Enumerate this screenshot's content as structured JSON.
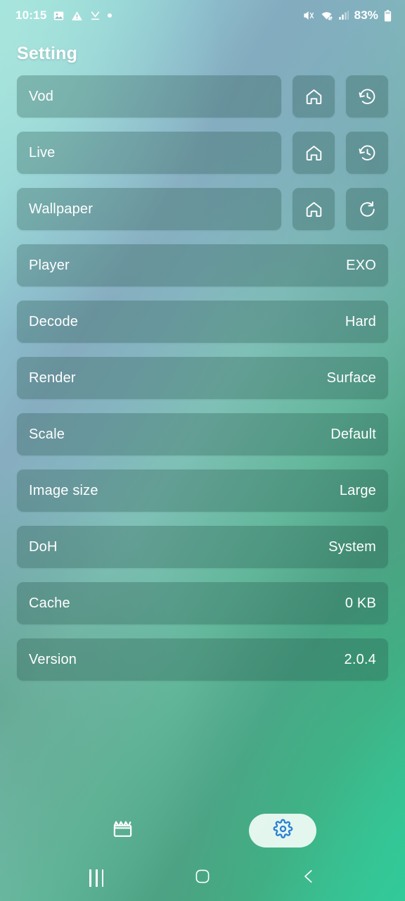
{
  "status_bar": {
    "time": "10:15",
    "battery_percent": "83%",
    "left_icons": [
      "photo-icon",
      "warning-triangle-icon",
      "download-complete-icon",
      "dot-indicator-icon"
    ],
    "right_icons": [
      "mute-icon",
      "wifi-data-icon",
      "signal-bars-icon",
      "battery-icon"
    ]
  },
  "header": {
    "title": "Setting"
  },
  "settings": {
    "rows": [
      {
        "label": "Vod",
        "value": "",
        "actions": [
          "home-icon",
          "history-icon"
        ]
      },
      {
        "label": "Live",
        "value": "",
        "actions": [
          "home-icon",
          "history-icon"
        ]
      },
      {
        "label": "Wallpaper",
        "value": "",
        "actions": [
          "home-icon",
          "refresh-icon"
        ]
      },
      {
        "label": "Player",
        "value": "EXO",
        "actions": []
      },
      {
        "label": "Decode",
        "value": "Hard",
        "actions": []
      },
      {
        "label": "Render",
        "value": "Surface",
        "actions": []
      },
      {
        "label": "Scale",
        "value": "Default",
        "actions": []
      },
      {
        "label": "Image size",
        "value": "Large",
        "actions": []
      },
      {
        "label": "DoH",
        "value": "System",
        "actions": []
      },
      {
        "label": "Cache",
        "value": "0 KB",
        "actions": []
      },
      {
        "label": "Version",
        "value": "2.0.4",
        "actions": []
      }
    ]
  },
  "tabbar": {
    "tabs": [
      {
        "icon": "movie-clapper-icon",
        "active": false
      },
      {
        "icon": "gear-icon",
        "active": true
      }
    ],
    "active_color": "#2a7fd4",
    "inactive_color": "#ffffff"
  },
  "navbar": {
    "items": [
      "recents-icon",
      "home-icon",
      "back-icon"
    ]
  },
  "colors": {
    "card_fill": "rgba(38,84,72,0.30)",
    "text": "#ffffff",
    "gradient_start": "#9fe3dd",
    "gradient_mid": "#86adc0",
    "gradient_end": "#36c79a"
  }
}
